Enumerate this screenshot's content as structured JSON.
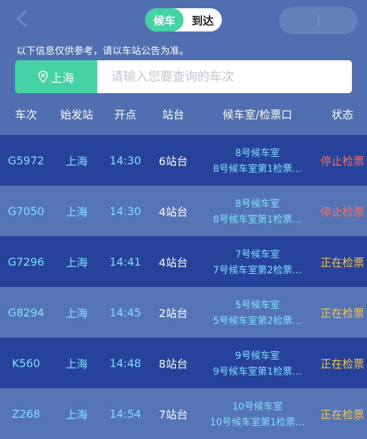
{
  "toggle": {
    "active_label": "候车",
    "inactive_label": "到达"
  },
  "notice": "以下信息仅供参考，请以车站公告为准。",
  "search": {
    "station": "上海",
    "placeholder": "请输入您要查询的车次"
  },
  "columns": [
    "车次",
    "始发站",
    "开点",
    "站台",
    "候车室/检票口",
    "状态"
  ],
  "rows": [
    {
      "train": "G5972",
      "origin": "上海",
      "depart": "14:30",
      "platform": "6站台",
      "waiting_room": "8号候车室",
      "gate": "8号候车室第1检票…",
      "status": "停止检票",
      "status_type": "stopped"
    },
    {
      "train": "G7050",
      "origin": "上海",
      "depart": "14:30",
      "platform": "4站台",
      "waiting_room": "8号候车室",
      "gate": "8号候车室第1检票…",
      "status": "停止检票",
      "status_type": "stopped"
    },
    {
      "train": "G7296",
      "origin": "上海",
      "depart": "14:41",
      "platform": "4站台",
      "waiting_room": "7号候车室",
      "gate": "7号候车室第2检票…",
      "status": "正在检票",
      "status_type": "checking"
    },
    {
      "train": "G8294",
      "origin": "上海",
      "depart": "14:45",
      "platform": "2站台",
      "waiting_room": "5号候车室",
      "gate": "5号候车室第2检票…",
      "status": "正在检票",
      "status_type": "checking"
    },
    {
      "train": "K560",
      "origin": "上海",
      "depart": "14:48",
      "platform": "8站台",
      "waiting_room": "9号候车室",
      "gate": "9号候车室第1检票…",
      "status": "正在检票",
      "status_type": "checking"
    },
    {
      "train": "Z268",
      "origin": "上海",
      "depart": "14:54",
      "platform": "7站台",
      "waiting_room": "10号候车室",
      "gate": "10号候车室第1检票…",
      "status": "正在检票",
      "status_type": "checking"
    }
  ],
  "colors": {
    "accent": "#45d3a6",
    "background": "#4f6fb0",
    "row_dark": "#26429a",
    "row_light": "#5574b5",
    "text_cyan": "#7fe0ff",
    "status_stopped": "#ff6b5d",
    "status_checking": "#f6c646"
  },
  "icons": {
    "back": "chevron-left-icon",
    "location": "location-pin-icon"
  }
}
